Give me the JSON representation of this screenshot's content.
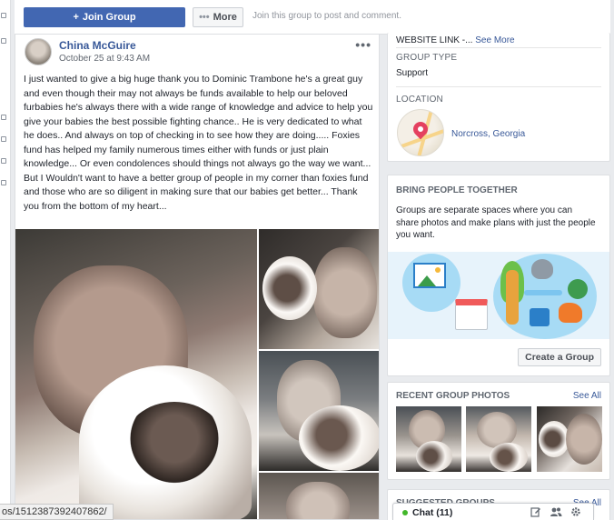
{
  "topbar": {
    "join_label": "Join Group",
    "join_icon": "plus-icon",
    "more_label": "More",
    "more_icon": "dots-icon",
    "hint": "Join this group to post and comment."
  },
  "post": {
    "author": "China McGuire",
    "timestamp": "October 25 at 9:43 AM",
    "menu_glyph": "•••",
    "text": "I just wanted to give a big huge thank you to Dominic Trambone he's a great guy and even though their may not always be funds available to help our beloved furbabies he's always there with a wide range of knowledge and advice to help you give your babies the best possible fighting chance.. He is very dedicated to what he does.. And always on top of checking in to see how they are doing..... Foxies fund has helped my family numerous times either with funds or just plain knowledge... Or even condolences should things not always go the way we want... But I Wouldn't want to have a better group of people in my corner than foxies fund and those who are so diligent in making sure that our babies get better... Thank you from the bottom of my heart..."
  },
  "status_url": "os/1512387392407862/",
  "about": {
    "website_text": "WEBSITE LINK -...",
    "website_see_more": "See More",
    "group_type_label": "GROUP TYPE",
    "group_type_value": "Support",
    "location_label": "LOCATION",
    "location_value": "Norcross, Georgia"
  },
  "bring": {
    "title": "BRING PEOPLE TOGETHER",
    "description": "Groups are separate spaces where you can share photos and make plans with just the people you want.",
    "button": "Create a Group"
  },
  "recent_photos": {
    "title": "RECENT GROUP PHOTOS",
    "see_all": "See All"
  },
  "suggested": {
    "title": "Suggested Groups",
    "see_all": "See All"
  },
  "chat": {
    "label": "Chat (11)",
    "status_color": "#42b72a",
    "icons": [
      "compose-icon",
      "people-icon",
      "settings-gear-icon"
    ]
  },
  "colors": {
    "brand": "#4267b2",
    "link": "#385898"
  }
}
